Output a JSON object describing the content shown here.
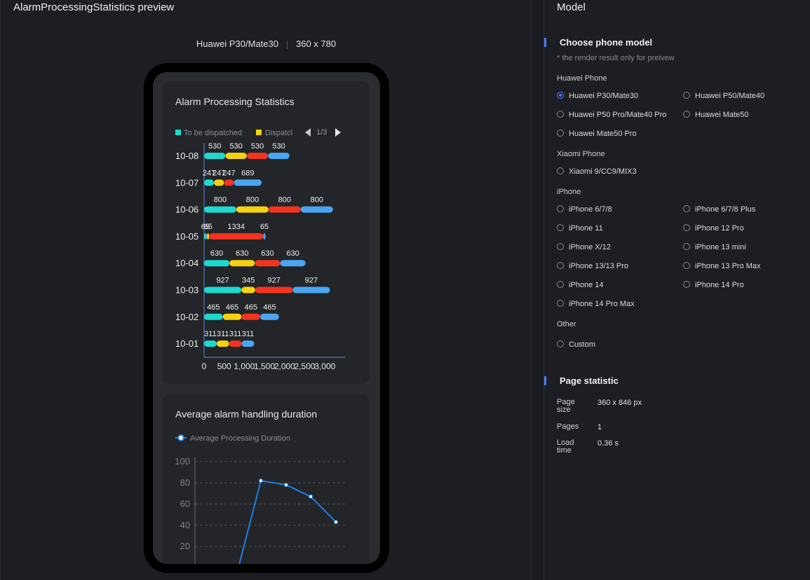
{
  "preview": {
    "title": "AlarmProcessingStatistics preview",
    "device_name": "Huawei P30/Mate30",
    "device_size": "360 x 780"
  },
  "card1": {
    "title": "Alarm Processing Statistics",
    "legend": [
      "To be dispatched",
      "Dispatcl"
    ],
    "pager": "1/3"
  },
  "card2": {
    "title": "Average alarm handling duration",
    "legend": "Average Processing Duration"
  },
  "chart_data": [
    {
      "type": "bar",
      "stacked": true,
      "orientation": "horizontal",
      "title": "Alarm Processing Statistics",
      "categories": [
        "10-08",
        "10-07",
        "10-06",
        "10-05",
        "10-04",
        "10-03",
        "10-02",
        "10-01"
      ],
      "series": [
        {
          "name": "To be dispatched",
          "color": "#1ed9d0",
          "values": [
            530,
            247,
            800,
            65,
            630,
            927,
            465,
            311
          ]
        },
        {
          "name": "Dispatcl",
          "color": "#f5d20f",
          "values": [
            530,
            247,
            800,
            65,
            630,
            345,
            465,
            311
          ]
        },
        {
          "color": "#f5331e",
          "values": [
            530,
            247,
            800,
            1334,
            630,
            927,
            465,
            311
          ]
        },
        {
          "color": "#4aa6f2",
          "values": [
            530,
            689,
            800,
            65,
            630,
            927,
            465,
            311
          ]
        }
      ],
      "xticks": [
        "0",
        "500",
        "1,000",
        "1,500",
        "2,000",
        "2,500",
        "3,000"
      ],
      "xlim": [
        0,
        3500
      ]
    },
    {
      "type": "line",
      "title": "Average alarm handling duration",
      "series": [
        {
          "name": "Average Processing Duration",
          "color": "#1f7ee0",
          "values": [
            0,
            82,
            78,
            67,
            43
          ]
        }
      ],
      "yticks": [
        "100",
        "80",
        "60",
        "40",
        "20"
      ],
      "ylim": [
        0,
        100
      ],
      "grid": true
    }
  ],
  "sidebar": {
    "title": "Model",
    "choose_title": "Choose phone model",
    "note": "* the render result only for preivew",
    "groups": {
      "huawei": "Huawei Phone",
      "xiaomi": "Xiaomi Phone",
      "iphone": "iPhone",
      "other": "Other"
    },
    "options": {
      "p30": "Huawei P30/Mate30",
      "p50": "Huawei P50/Mate40",
      "p50pro": "Huawei P50 Pro/Mate40 Pro",
      "mate50": "Huawei Mate50",
      "mate50pro": "Huawei Mate50 Pro",
      "xiaomi9": "Xiaomi 9/CC9/MIX3",
      "ip678": "iPhone 6/7/8",
      "ip678plus": "iPhone 6/7/8 Plus",
      "ip11": "iPhone 11",
      "ip12pro": "iPhone 12 Pro",
      "ipx12": "iPhone X/12",
      "ip13mini": "iPhone 13 mini",
      "ip13": "iPhone 13/13 Pro",
      "ip13promax": "iPhone 13 Pro Max",
      "ip14": "iPhone 14",
      "ip14pro": "iPhone 14 Pro",
      "ip14promax": "iPhone 14 Pro Max",
      "custom": "Custom"
    },
    "selected": "Huawei P30/Mate30",
    "stats_title": "Page statistic",
    "stats": {
      "size_label": "Page size",
      "size_value": "360 x 846 px",
      "pages_label": "Pages",
      "pages_value": "1",
      "load_label": "Load time",
      "load_value": "0.36 s"
    }
  }
}
